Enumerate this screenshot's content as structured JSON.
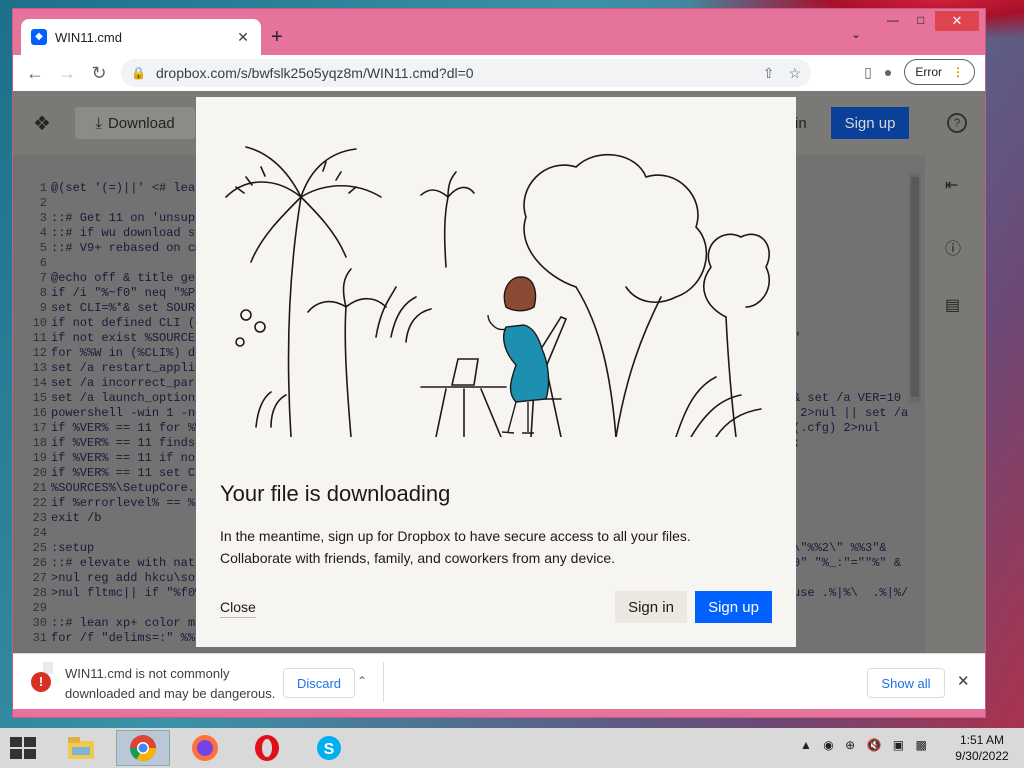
{
  "browser": {
    "tab_title": "WIN11.cmd",
    "url": "dropbox.com/s/bwfslk25o5yqz8m/WIN11.cmd?dl=0",
    "error_label": "Error"
  },
  "dropbox_bar": {
    "download_label": "Download",
    "signin_label": "in",
    "signup_label": "Sign up"
  },
  "code_lines": [
    {
      "n": "1",
      "t": "@(set '(=)||' <# lean"
    },
    {
      "n": "2",
      "t": ""
    },
    {
      "n": "3",
      "t": "::# Get 11 on 'unsuppo"
    },
    {
      "n": "4",
      "t": "::# if wu download stu"
    },
    {
      "n": "5",
      "t": "::# V9+ rebased on cmd"
    },
    {
      "n": "6",
      "t": ""
    },
    {
      "n": "7",
      "t": "@echo off & title get"
    },
    {
      "n": "8",
      "t": "if /i \"%~f0\" neq \"%Pro"
    },
    {
      "n": "9",
      "t": "set CLI=%*& set SOURCE"
    },
    {
      "n": "10",
      "t": "if not defined CLI (ex"
    },
    {
      "n": "11",
      "t": "if not exist %SOURCES%"
    },
    {
      "n": "12",
      "t": "for %%W in (%CLI%) do"
    },
    {
      "n": "13",
      "t": "set /a restart_applica"
    },
    {
      "n": "14",
      "t": "set /a incorrect_param"
    },
    {
      "n": "15",
      "t": "set /a launch_option_e"
    },
    {
      "n": "16",
      "t": "powershell -win 1 -nop"
    },
    {
      "n": "17",
      "t": "if %VER% == 11 for %%W"
    },
    {
      "n": "18",
      "t": "if %VER% == 11 findstr"
    },
    {
      "n": "19",
      "t": "if %VER% == 11 if not"
    },
    {
      "n": "20",
      "t": "if %VER% == 11 set CLI"
    },
    {
      "n": "21",
      "t": "%SOURCES%\\SetupCore.ex"
    },
    {
      "n": "22",
      "t": "if %errorlevel% == %re"
    },
    {
      "n": "23",
      "t": "exit /b"
    },
    {
      "n": "24",
      "t": ""
    },
    {
      "n": "25",
      "t": ":setup"
    },
    {
      "n": "26",
      "t": "::# elevate with nativ"
    },
    {
      "n": "27",
      "t": ">nul reg add hkcu\\soft"
    },
    {
      "n": "28",
      "t": ">nul fltmc|| if \"%f0%\""
    },
    {
      "n": "29",
      "t": ""
    },
    {
      "n": "30",
      "t": "::# lean xp+ color mac"
    },
    {
      "n": "31",
      "t": "for /f \"delims=:\" %%s"
    }
  ],
  "right_code_lines": [
    "\"",
    "",
    "",
    "",
    "& set /a VER=10",
    " 2>nul || set /a",
    "(.cfg) 2>nul",
    ";",
    "",
    "",
    "",
    "",
    "",
    "",
    "\\\"%%2\\\" %%3\"&",
    "0\" \"%_:\"=\"\"%\" &",
    "",
    "use .%|%\\  .%|%/"
  ],
  "modal": {
    "title": "Your file is downloading",
    "body": "In the meantime, sign up for Dropbox to have secure access to all your files. Collaborate with friends, family, and coworkers from any device.",
    "close_label": "Close",
    "signin_label": "Sign in",
    "signup_label": "Sign up"
  },
  "download_shelf": {
    "warning_text": "WIN11.cmd is not commonly downloaded and may be dangerous.",
    "discard_label": "Discard",
    "show_all_label": "Show all"
  },
  "taskbar": {
    "time": "1:51 AM",
    "date": "9/30/2022"
  },
  "colors": {
    "window_frame": "#e5739c",
    "dropbox_blue": "#0061fe",
    "warning_red": "#d93025",
    "modal_bg": "#f7f5f2"
  },
  "icons": {
    "tab_favicon": "dropbox-icon",
    "back": "arrow-left-icon",
    "forward": "arrow-right-icon",
    "reload": "reload-icon",
    "lock": "lock-icon",
    "share": "share-icon",
    "star": "star-icon",
    "sidepanel": "sidepanel-icon",
    "profile": "profile-icon",
    "menu": "kebab-menu-icon"
  }
}
